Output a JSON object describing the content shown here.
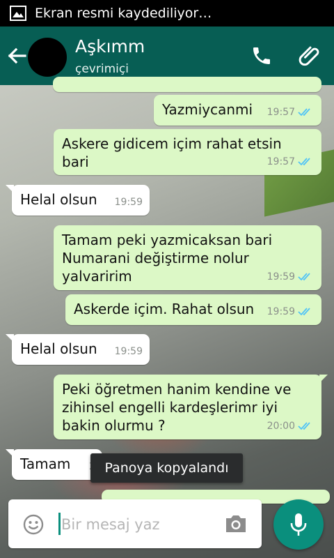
{
  "status_bar": {
    "text": "Ekran resmi kaydediliyor…",
    "icon": "image-icon"
  },
  "header": {
    "contact_name": "Aşkımm",
    "contact_status": "çevrimiçi",
    "icons": [
      "back-arrow-icon",
      "phone-icon",
      "paperclip-icon"
    ],
    "color": "#075e54"
  },
  "messages": [
    {
      "direction": "out",
      "text": "Yazmiycanmi",
      "time": "19:57",
      "read": true
    },
    {
      "direction": "out",
      "text": "Askere gidicem içim rahat etsin\nbari",
      "time": "19:57",
      "read": true
    },
    {
      "direction": "in",
      "text": "Helal olsun",
      "time": "19:59"
    },
    {
      "direction": "out",
      "text": "Tamam peki yazmicaksan bari\nNumarani değiştirme nolur\nyalvaririm",
      "time": "19:59",
      "read": true
    },
    {
      "direction": "out",
      "text": "Askerde içim. Rahat olsun",
      "time": "19:59",
      "read": true
    },
    {
      "direction": "in",
      "text": "Helal olsun",
      "time": "19:59"
    },
    {
      "direction": "out",
      "text": "Peki öğretmen hanim kendine ve\nzihinsel engelli kardeşlerimr iyi\nbakin olurmu ?",
      "time": "20:00",
      "read": true
    },
    {
      "direction": "in",
      "text": "Tamam",
      "time": "2"
    }
  ],
  "toast": {
    "text": "Panoya kopyalandı"
  },
  "composer": {
    "placeholder": "Bir mesaj yaz",
    "value": "",
    "icons": [
      "emoji-icon",
      "camera-icon",
      "microphone-icon"
    ],
    "accent": "#0a8f7d"
  },
  "colors": {
    "outgoing_bubble": "#dcf8c6",
    "incoming_bubble": "#ffffff",
    "read_ticks": "#4fc3f7"
  }
}
